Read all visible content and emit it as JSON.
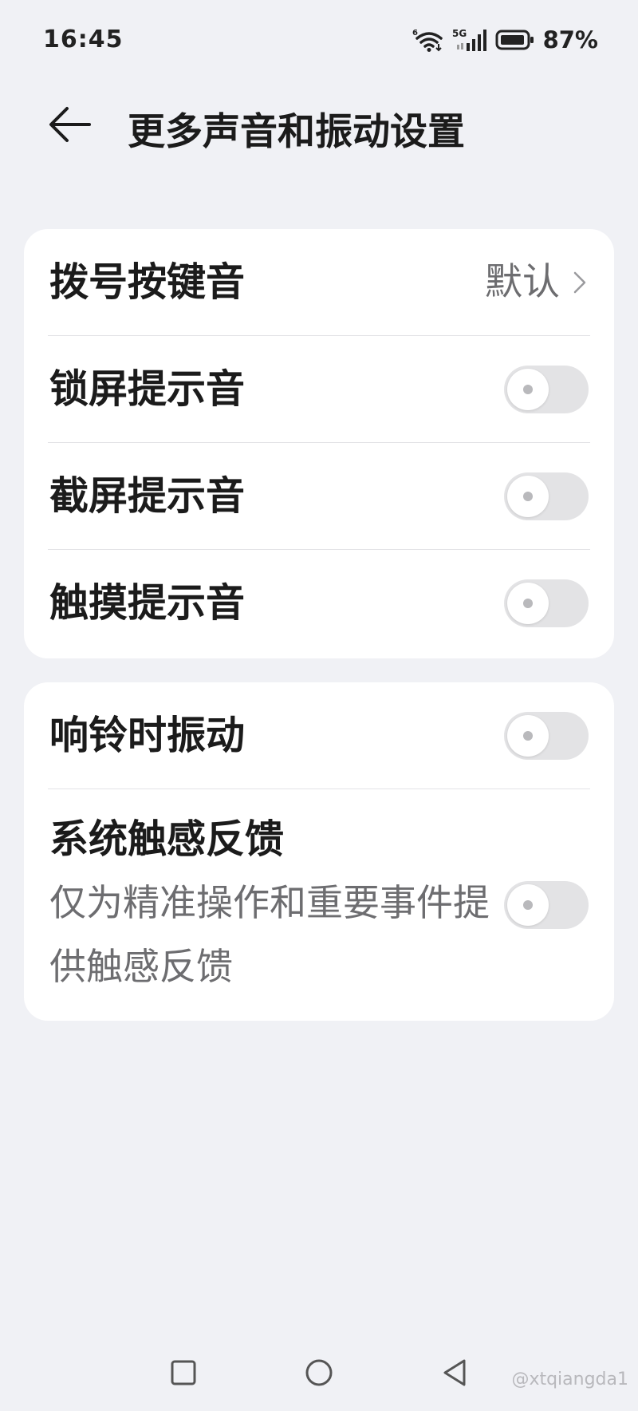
{
  "status_bar": {
    "time": "16:45",
    "battery": "87%",
    "wifi_badge": "6",
    "network": "5G",
    "icons": [
      "wifi-icon",
      "signal-icon",
      "battery-icon"
    ]
  },
  "header": {
    "title": "更多声音和振动设置",
    "back_icon": "arrow-left-icon"
  },
  "sound_group": {
    "items": [
      {
        "label": "拨号按键音",
        "value": "默认",
        "type": "link"
      },
      {
        "label": "锁屏提示音",
        "type": "toggle",
        "on": false
      },
      {
        "label": "截屏提示音",
        "type": "toggle",
        "on": false
      },
      {
        "label": "触摸提示音",
        "type": "toggle",
        "on": false
      }
    ]
  },
  "vibration_group": {
    "items": [
      {
        "label": "响铃时振动",
        "type": "toggle",
        "on": false
      },
      {
        "label": "系统触感反馈",
        "subtitle": "仅为精准操作和重要事件提供触感反馈",
        "type": "toggle",
        "on": false
      }
    ]
  },
  "nav_bar": {
    "buttons": [
      "square-icon",
      "circle-icon",
      "triangle-back-icon"
    ]
  },
  "watermark": "@xtqiangda1",
  "colors": {
    "background": "#f0f1f5",
    "card": "#ffffff",
    "toggle_off": "#e3e3e5",
    "secondary_text": "#6d6d70"
  }
}
